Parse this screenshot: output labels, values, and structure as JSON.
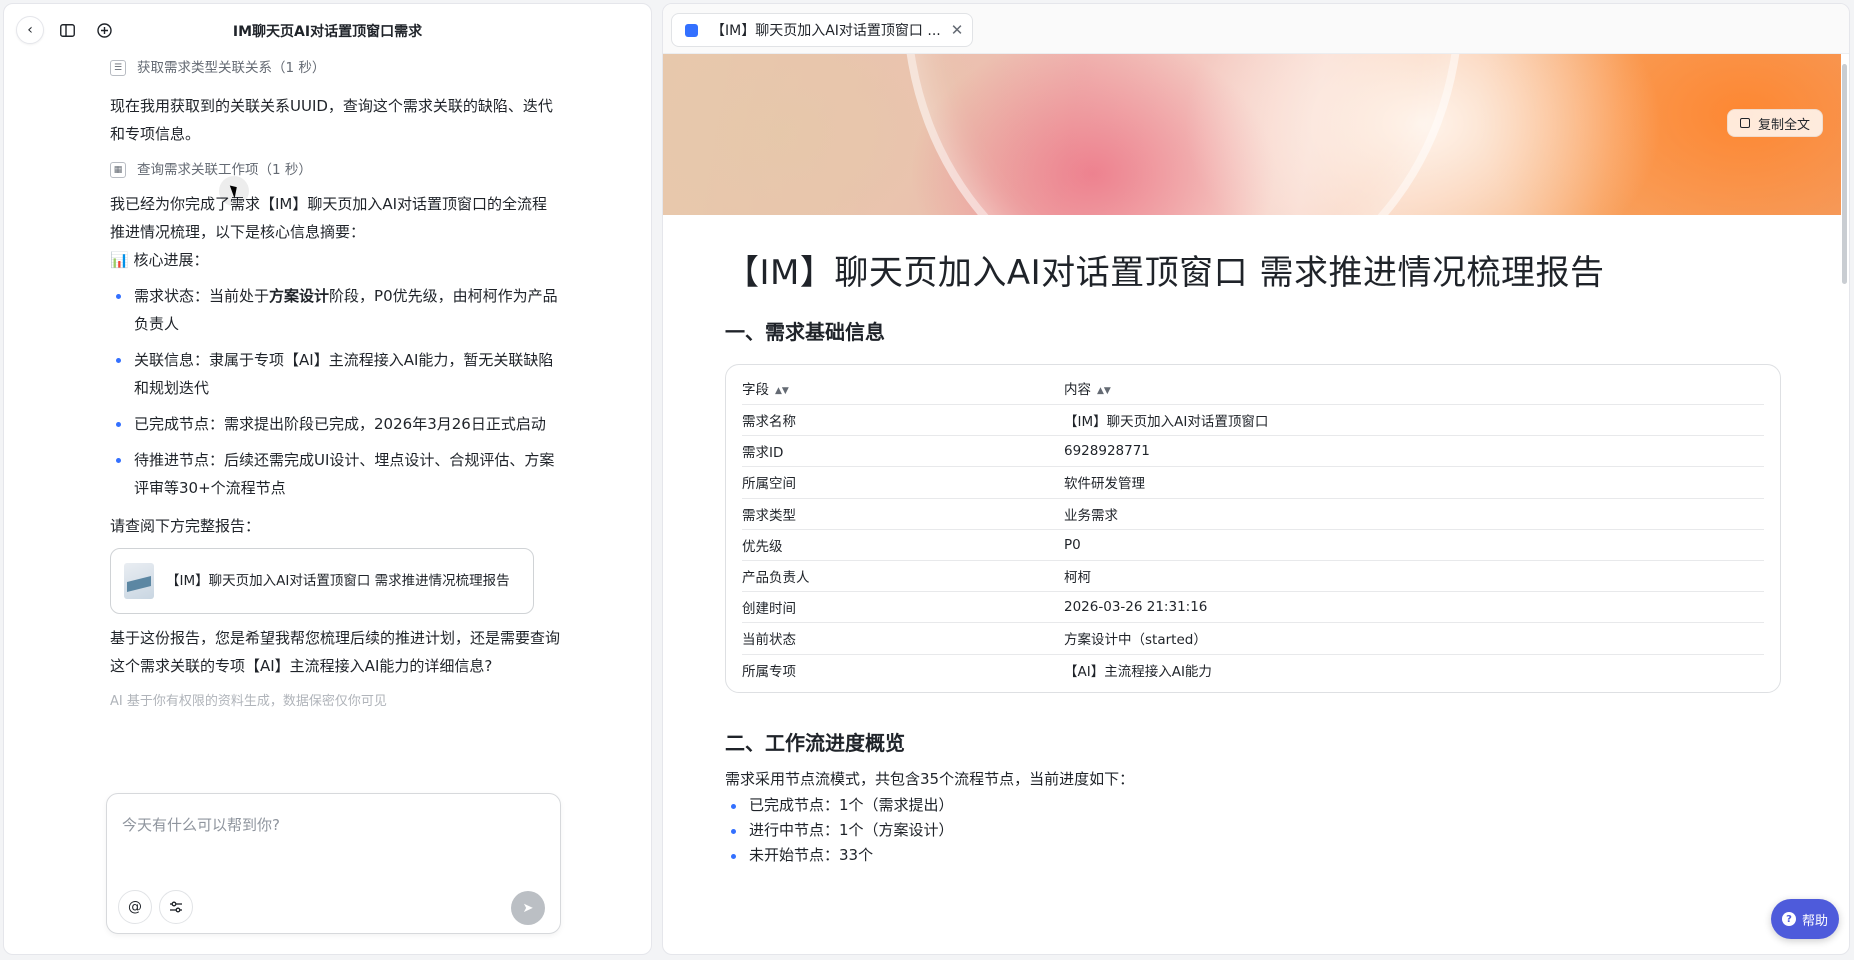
{
  "left_header": {
    "title": "IM聊天页AI对话置顶窗口需求"
  },
  "chat": {
    "tool1": "获取需求类型关联关系（1 秒）",
    "para1": "现在我用获取到的关联关系UUID，查询这个需求关联的缺陷、迭代和专项信息。",
    "tool2": "查询需求关联工作项（1 秒）",
    "para2": "我已经为你完成了需求【IM】聊天页加入AI对话置顶窗口的全流程推进情况梳理，以下是核心信息摘要：",
    "progress_heading": "📊 核心进展：",
    "bullets": [
      {
        "label": "需求状态：",
        "pre": "当前处于",
        "bold": "方案设计",
        "post": "阶段，P0优先级，由柯柯作为产品负责人"
      },
      {
        "label": "关联信息：",
        "pre": "隶属于专项【AI】主流程接入AI能力，暂无关联缺陷和规划迭代",
        "bold": "",
        "post": ""
      },
      {
        "label": "已完成节点：",
        "pre": "需求提出阶段已完成，2026年3月26日正式启动",
        "bold": "",
        "post": ""
      },
      {
        "label": "待推进节点：",
        "pre": "后续还需完成UI设计、埋点设计、合规评估、方案评审等30+个流程节点",
        "bold": "",
        "post": ""
      }
    ],
    "para3": "请查阅下方完整报告：",
    "card_title": "【IM】聊天页加入AI对话置顶窗口 需求推进情况梳理报告",
    "para4": "基于这份报告，您是希望我帮您梳理后续的推进计划，还是需要查询这个需求关联的专项【AI】主流程接入AI能力的详细信息?",
    "disclaimer": "AI 基于你有权限的资料生成，数据保密仅你可见"
  },
  "composer": {
    "placeholder": "今天有什么可以帮到你?"
  },
  "tab": {
    "title": "【IM】聊天页加入AI对话置顶窗口 ..."
  },
  "copy_button": "复制全文",
  "doc": {
    "title": "【IM】聊天页加入AI对话置顶窗口 需求推进情况梳理报告",
    "section1": "一、需求基础信息",
    "table_headers": [
      "字段",
      "内容"
    ],
    "table_rows": [
      [
        "需求名称",
        "【IM】聊天页加入AI对话置顶窗口"
      ],
      [
        "需求ID",
        "6928928771"
      ],
      [
        "所属空间",
        "软件研发管理"
      ],
      [
        "需求类型",
        "业务需求"
      ],
      [
        "优先级",
        "P0"
      ],
      [
        "产品负责人",
        "柯柯"
      ],
      [
        "创建时间",
        "2026-03-26 21:31:16"
      ],
      [
        "当前状态",
        "方案设计中（started）"
      ],
      [
        "所属专项",
        "【AI】主流程接入AI能力"
      ]
    ],
    "section2": "二、工作流进度概览",
    "section2_intro": "需求采用节点流模式，共包含35个流程节点，当前进度如下：",
    "section2_items": [
      "已完成节点：1个（需求提出）",
      "进行中节点：1个（方案设计）",
      "未开始节点：33个"
    ]
  },
  "help_button": "帮助",
  "colors": {
    "accent": "#3370ff",
    "help": "#4e5bdb"
  }
}
